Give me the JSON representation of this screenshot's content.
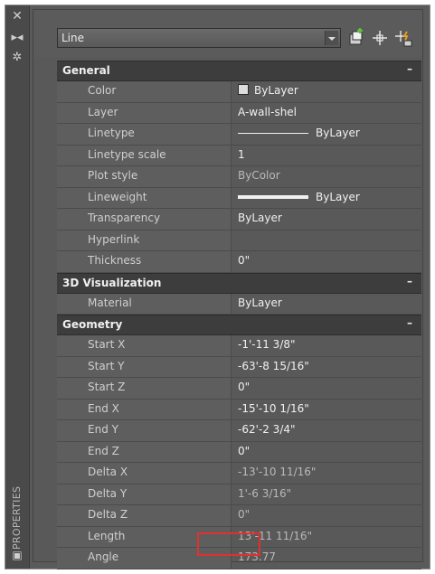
{
  "panel": {
    "vertical_title": "PROPERTIES",
    "selection": "Line"
  },
  "sections": [
    {
      "title": "General",
      "toggle": "–",
      "rows": [
        {
          "name": "Color",
          "value": "ByLayer",
          "kind": "color",
          "swatch_color": "#dcdcdc"
        },
        {
          "name": "Layer",
          "value": "A-wall-shel",
          "kind": "text"
        },
        {
          "name": "Linetype",
          "value": "ByLayer",
          "kind": "linetype"
        },
        {
          "name": "Linetype scale",
          "value": "1",
          "kind": "text"
        },
        {
          "name": "Plot style",
          "value": "ByColor",
          "kind": "dim"
        },
        {
          "name": "Lineweight",
          "value": "ByLayer",
          "kind": "lineweight"
        },
        {
          "name": "Transparency",
          "value": "ByLayer",
          "kind": "text"
        },
        {
          "name": "Hyperlink",
          "value": "",
          "kind": "text"
        },
        {
          "name": "Thickness",
          "value": "0\"",
          "kind": "text"
        }
      ]
    },
    {
      "title": "3D Visualization",
      "toggle": "–",
      "rows": [
        {
          "name": "Material",
          "value": "ByLayer",
          "kind": "text"
        }
      ]
    },
    {
      "title": "Geometry",
      "toggle": "–",
      "rows": [
        {
          "name": "Start X",
          "value": "-1'-11 3/8\"",
          "kind": "text"
        },
        {
          "name": "Start Y",
          "value": "-63'-8 15/16\"",
          "kind": "text"
        },
        {
          "name": "Start Z",
          "value": "0\"",
          "kind": "text"
        },
        {
          "name": "End X",
          "value": "-15'-10 1/16\"",
          "kind": "text"
        },
        {
          "name": "End Y",
          "value": "-62'-2 3/4\"",
          "kind": "text"
        },
        {
          "name": "End Z",
          "value": "0\"",
          "kind": "text"
        },
        {
          "name": "Delta X",
          "value": "-13'-10 11/16\"",
          "kind": "dim"
        },
        {
          "name": "Delta Y",
          "value": "1'-6 3/16\"",
          "kind": "dim"
        },
        {
          "name": "Delta Z",
          "value": "0\"",
          "kind": "dim"
        },
        {
          "name": "Length",
          "value": "13'-11 11/16\"",
          "kind": "dim"
        },
        {
          "name": "Angle",
          "value": "173.77",
          "kind": "dim"
        }
      ]
    }
  ],
  "colors": {
    "highlight_box": "#e03030",
    "accent_green": "#5fbf3a",
    "accent_orange": "#f0a020"
  }
}
